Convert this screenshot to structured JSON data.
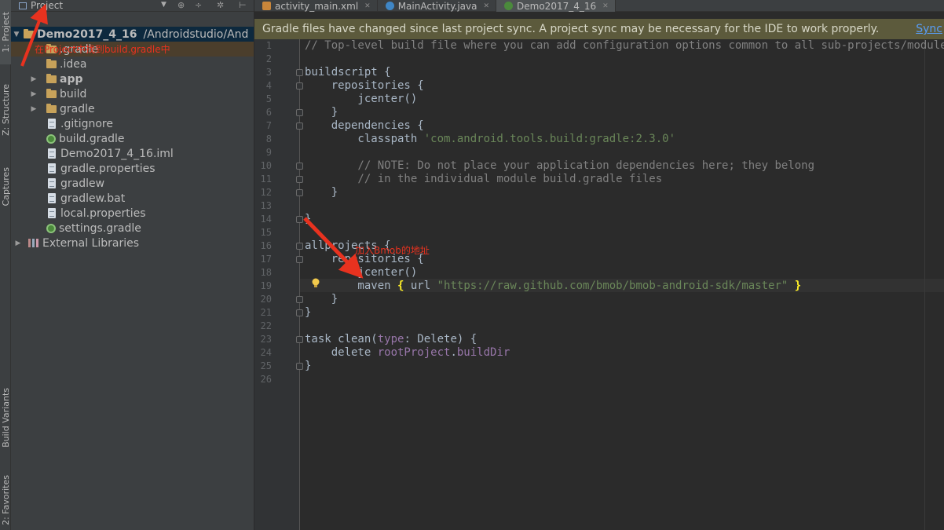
{
  "tool_strip": {
    "project_tab": "1: Project",
    "structure_tab": "Z: Structure",
    "captures_tab": "Captures",
    "build_variants_tab": "Build Variants",
    "favorites_tab": "2: Favorites"
  },
  "project_panel": {
    "header_label": "Project",
    "root": {
      "name": "Demo2017_4_16",
      "path": "/Androidstudio/And"
    },
    "items": [
      {
        "label": ".gradle",
        "type": "folder"
      },
      {
        "label": ".idea",
        "type": "folder"
      },
      {
        "label": "app",
        "type": "module"
      },
      {
        "label": "build",
        "type": "folder"
      },
      {
        "label": "gradle",
        "type": "folder"
      },
      {
        "label": ".gitignore",
        "type": "file"
      },
      {
        "label": "build.gradle",
        "type": "gradle"
      },
      {
        "label": "Demo2017_4_16.iml",
        "type": "file"
      },
      {
        "label": "gradle.properties",
        "type": "file"
      },
      {
        "label": "gradlew",
        "type": "file"
      },
      {
        "label": "gradlew.bat",
        "type": "file"
      },
      {
        "label": "local.properties",
        "type": "file"
      },
      {
        "label": "settings.gradle",
        "type": "gradle"
      }
    ],
    "external_libraries": "External Libraries"
  },
  "tabs": [
    {
      "label": "activity_main.xml",
      "icon": "xml-file-icon"
    },
    {
      "label": "MainActivity.java",
      "icon": "java-class-icon"
    },
    {
      "label": "Demo2017_4_16",
      "icon": "gradle-icon"
    }
  ],
  "notification": {
    "message": "Gradle files have changed since last project sync. A project sync may be necessary for the IDE to work properly.",
    "action": "Sync"
  },
  "editor": {
    "line_numbers": [
      "1",
      "2",
      "3",
      "4",
      "5",
      "6",
      "7",
      "8",
      "9",
      "10",
      "11",
      "12",
      "13",
      "14",
      "15",
      "16",
      "17",
      "18",
      "19",
      "20",
      "21",
      "22",
      "23",
      "24",
      "25",
      "26"
    ],
    "current_line": 19,
    "lines": {
      "l1": "// Top-level build file where you can add configuration options common to all sub-projects/modules.",
      "l3": "buildscript {",
      "l4": "    repositories {",
      "l5": "        jcenter()",
      "l6": "    }",
      "l7": "    dependencies {",
      "l8a": "        classpath ",
      "l8b": "'com.android.tools.build:gradle:2.3.0'",
      "l10": "        // NOTE: Do not place your application dependencies here; they belong",
      "l11": "        // in the individual module build.gradle files",
      "l12": "    }",
      "l14": "}",
      "l16": "allprojects {",
      "l17": "    repositories {",
      "l18": "        jcenter()",
      "l19a": "        maven ",
      "l19b": "{",
      "l19c": " url ",
      "l19d": "\"https://raw.github.com/bmob/bmob-android-sdk/master\"",
      "l19e": " ",
      "l19f": "}",
      "l20": "    }",
      "l21": "}",
      "l23a": "task clean(",
      "l23b": "type",
      "l23c": ": Delete) {",
      "l24a": "    delete ",
      "l24b": "rootProject",
      "l24c": ".",
      "l24d": "buildDir",
      "l25": "}"
    }
  },
  "annotations": {
    "top_note": "在Project中找到build.gradle中",
    "code_note": "加入Bmob的地址"
  },
  "colors": {
    "accent_annotation": "#e8321f",
    "notification_bg": "#5c5a3c",
    "link": "#589df6"
  }
}
